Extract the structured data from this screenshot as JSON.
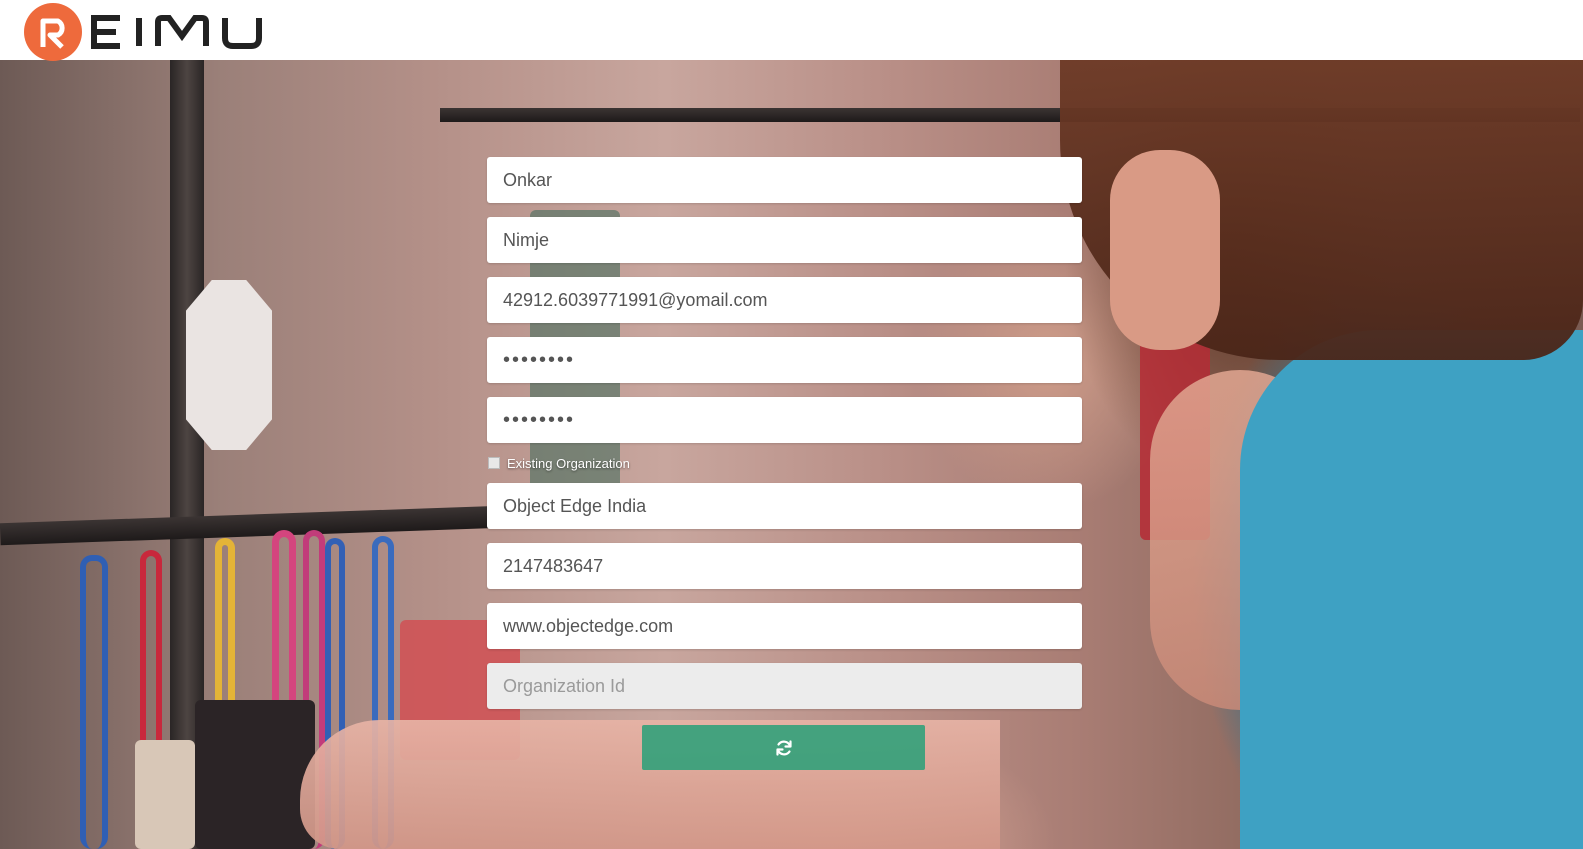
{
  "brand": {
    "logo_text": "REIMU",
    "accent_color": "#ee6a3c",
    "button_color": "#28a078"
  },
  "form": {
    "first_name": "Onkar",
    "last_name": "Nimje",
    "email": "42912.6039771991@yomail.com",
    "password": "••••••••",
    "confirm_password": "••••••••",
    "existing_org_label": "Existing Organization",
    "existing_org_checked": false,
    "organization_name": "Object Edge India",
    "phone": "2147483647",
    "website": "www.objectedge.com",
    "organization_id_placeholder": "Organization Id",
    "submit_icon": "refresh-icon"
  }
}
